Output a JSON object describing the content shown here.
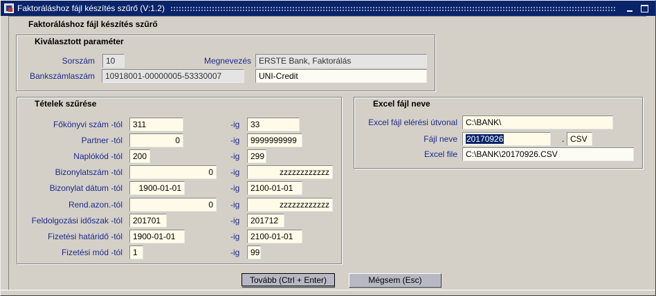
{
  "window": {
    "title": "Faktoráláshoz fájl készítés szűrő (V:1.2)"
  },
  "form": {
    "heading": "Faktoráláshoz fájl készítés szűrő"
  },
  "selected_param": {
    "title": "Kiválasztott paraméter",
    "sorszam_label": "Sorszám",
    "sorszam_value": "10",
    "megnevezes_label": "Megnevezés",
    "megnevezes_value": "ERSTE Bank, Faktorálás",
    "bankszamla_label": "Bankszámlaszám",
    "bankszamla_value": "10918001-00000005-53330007",
    "bank_name_value": "UNI-Credit"
  },
  "filters": {
    "title": "Tételek szűrése",
    "ig_label": "-ig",
    "rows": [
      {
        "label": "Főkönyvi szám -tól",
        "from": "311",
        "to": "33"
      },
      {
        "label": "Partner -tól",
        "from": "0",
        "to": "9999999999"
      },
      {
        "label": "Naplókód -tól",
        "from": "200",
        "to": "299"
      },
      {
        "label": "Bizonylatszám -tól",
        "from": "0",
        "to": "zzzzzzzzzzzz"
      },
      {
        "label": "Bizonylat dátum -tól",
        "from": "1900-01-01",
        "to": "2100-01-01"
      },
      {
        "label": "Rend.azon.-tól",
        "from": "0",
        "to": "zzzzzzzzzzzz"
      },
      {
        "label": "Feldolgozási időszak -tól",
        "from": "201701",
        "to": "201712"
      },
      {
        "label": "Fizetési határidő -tól",
        "from": "1900-01-01",
        "to": "2100-01-01"
      },
      {
        "label": "Fizetési mód -tól",
        "from": "1",
        "to": "99"
      }
    ]
  },
  "excel": {
    "title": "Excel fájl neve",
    "path_label": "Excel fájl elérési útvonal",
    "path_value": "C:\\BANK\\",
    "filename_label": "Fájl neve",
    "filename_value": "20170926",
    "ext_dot": ".",
    "ext_value": "CSV",
    "file_label": "Excel file",
    "file_value": "C:\\BANK\\20170926.CSV"
  },
  "buttons": {
    "next": "Tovább (Ctrl + Enter)",
    "cancel": "Mégsem (Esc)"
  }
}
